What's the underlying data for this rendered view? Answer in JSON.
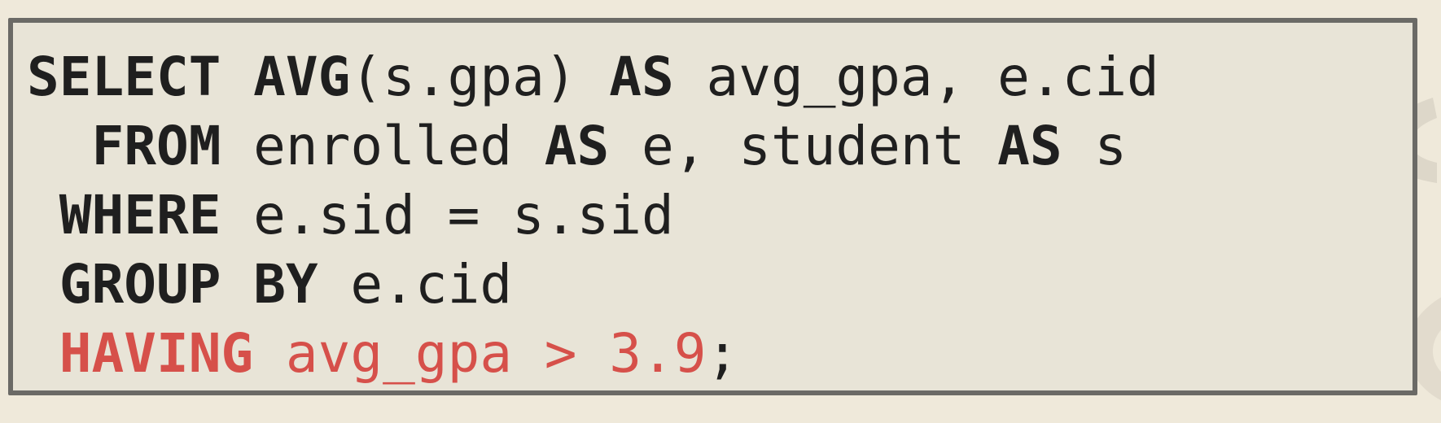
{
  "query": {
    "line1": {
      "select_kw": "SELECT",
      "avg_kw": "AVG",
      "avg_args": "(s.gpa) ",
      "as_kw": "AS",
      "rest": " avg_gpa, e.cid"
    },
    "line2": {
      "indent": "  ",
      "from_kw": "FROM",
      "table1": " enrolled ",
      "as_kw_1": "AS",
      "alias1": " e, student ",
      "as_kw_2": "AS",
      "alias2": " s"
    },
    "line3": {
      "indent": " ",
      "where_kw": "WHERE",
      "condition": " e.sid = s.sid"
    },
    "line4": {
      "indent": " ",
      "group_kw": "GROUP",
      "space": " ",
      "by_kw": "BY",
      "column": " e.cid"
    },
    "line5": {
      "indent": " ",
      "having_kw": "HAVING",
      "condition": " avg_gpa > 3.9",
      "terminator": ";"
    }
  },
  "colors": {
    "background": "#efe9da",
    "code_background": "#e8e4d7",
    "border": "#6b6a66",
    "text": "#1f1f1f",
    "highlight": "#d6504a"
  }
}
